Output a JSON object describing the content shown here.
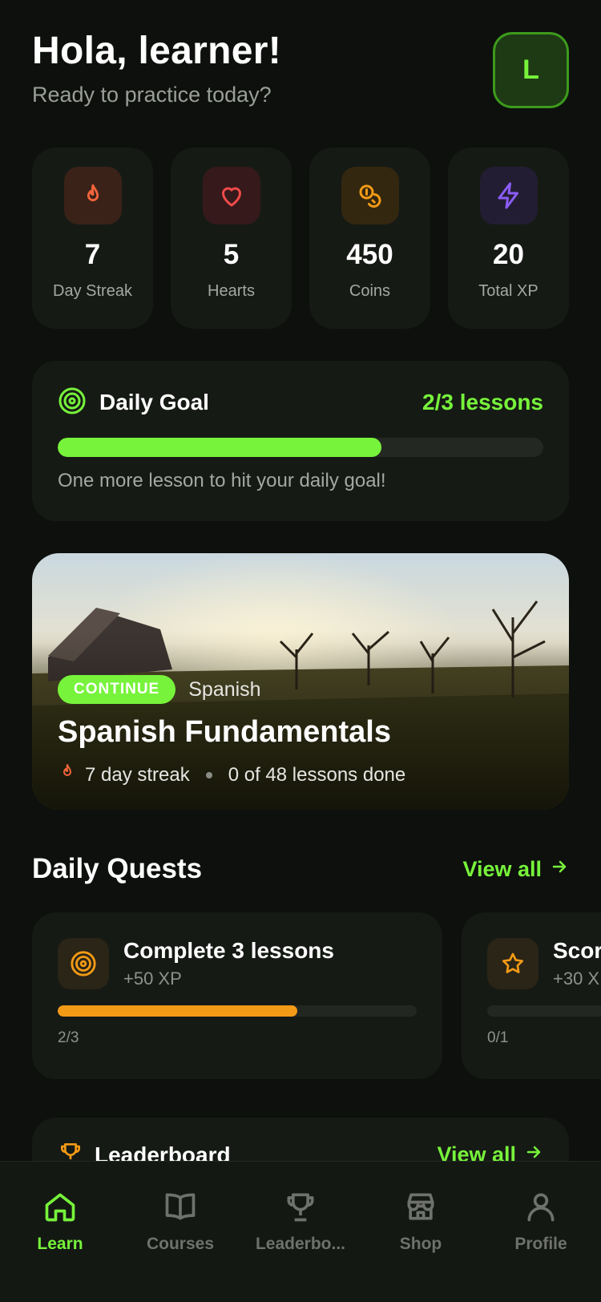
{
  "header": {
    "greeting": "Hola, learner!",
    "subtitle": "Ready to practice today?",
    "avatar_initial": "L"
  },
  "stats": [
    {
      "value": "7",
      "label": "Day Streak",
      "icon": "flame-icon",
      "color": "#f2643b"
    },
    {
      "value": "5",
      "label": "Hearts",
      "icon": "heart-icon",
      "color": "#ef4a4a"
    },
    {
      "value": "450",
      "label": "Coins",
      "icon": "coins-icon",
      "color": "#f39a16"
    },
    {
      "value": "20",
      "label": "Total XP",
      "icon": "lightning-icon",
      "color": "#8b5cf6"
    }
  ],
  "daily_goal": {
    "title": "Daily Goal",
    "count": "2/3 lessons",
    "progress": 0.6667,
    "message": "One more lesson to hit your daily goal!"
  },
  "course": {
    "badge": "CONTINUE",
    "language": "Spanish",
    "title": "Spanish Fundamentals",
    "streak": "7 day streak",
    "lessons": "0 of 48 lessons done"
  },
  "quests": {
    "title": "Daily Quests",
    "view_all": "View all",
    "items": [
      {
        "title": "Complete 3 lessons",
        "xp": "+50 XP",
        "progress_text": "2/3",
        "progress": 0.6667,
        "icon": "target-icon"
      },
      {
        "title": "Score",
        "xp": "+30 X",
        "progress_text": "0/1",
        "progress": 0,
        "icon": "star-icon"
      }
    ]
  },
  "leaderboard": {
    "title": "Leaderboard",
    "view_all": "View all"
  },
  "nav": [
    {
      "label": "Learn",
      "icon": "home-icon",
      "active": true
    },
    {
      "label": "Courses",
      "icon": "book-icon",
      "active": false
    },
    {
      "label": "Leaderbo...",
      "icon": "trophy-icon",
      "active": false
    },
    {
      "label": "Shop",
      "icon": "shop-icon",
      "active": false
    },
    {
      "label": "Profile",
      "icon": "user-icon",
      "active": false
    }
  ],
  "colors": {
    "accent": "#77f33b",
    "background": "#0d100c",
    "card": "#161a15",
    "quest_bar": "#f39a16"
  }
}
